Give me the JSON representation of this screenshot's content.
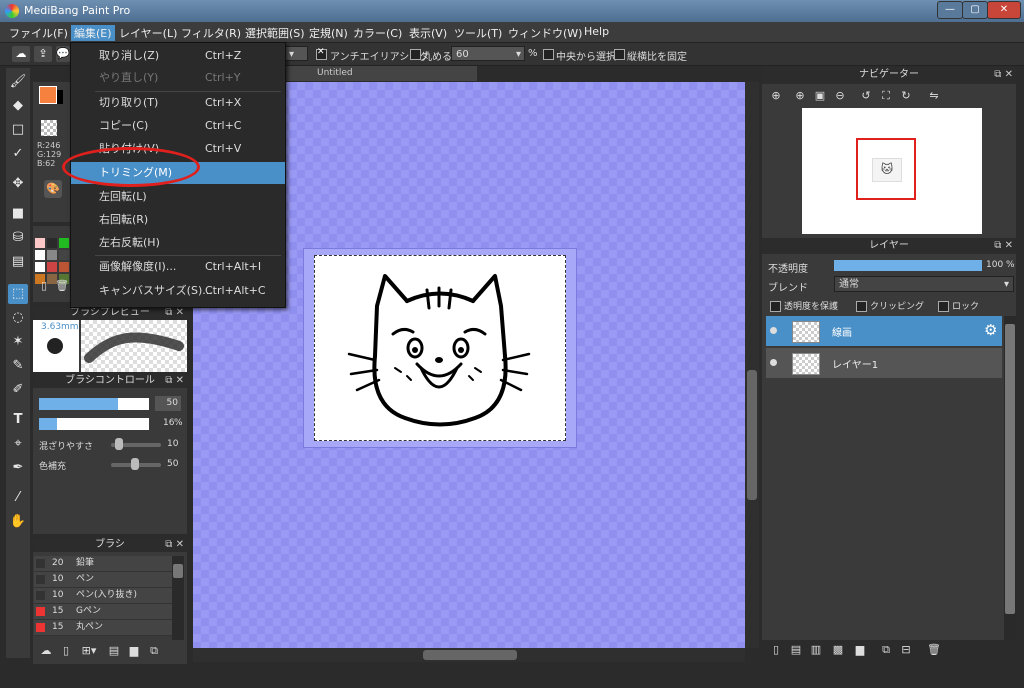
{
  "window": {
    "title": "MediBang Paint Pro",
    "min": "—",
    "max": "▢",
    "close": "✕"
  },
  "menubar": [
    "ファイル(F)",
    "編集(E)",
    "レイヤー(L)",
    "フィルタ(R)",
    "選択範囲(S)",
    "定規(N)",
    "カラー(C)",
    "表示(V)",
    "ツール(T)",
    "ウィンドウ(W)",
    "Help"
  ],
  "toolbar": {
    "antialias": "アンチエイリアシング",
    "round": "丸める",
    "round_value": "60",
    "percent": "%",
    "from_center": "中央から選択",
    "fixed_ratio": "縦横比を固定"
  },
  "edit_menu": [
    {
      "label": "取り消し(Z)",
      "shortcut": "Ctrl+Z",
      "disabled": false
    },
    {
      "label": "やり直し(Y)",
      "shortcut": "Ctrl+Y",
      "disabled": true
    },
    {
      "label": "切り取り(T)",
      "shortcut": "Ctrl+X",
      "disabled": false
    },
    {
      "label": "コピー(C)",
      "shortcut": "Ctrl+C",
      "disabled": false
    },
    {
      "label": "貼り付け(V)",
      "shortcut": "Ctrl+V",
      "disabled": false
    },
    {
      "label": "トリミング(M)",
      "shortcut": "",
      "disabled": false
    },
    {
      "label": "左回転(L)",
      "shortcut": "",
      "disabled": false
    },
    {
      "label": "右回転(R)",
      "shortcut": "",
      "disabled": false
    },
    {
      "label": "左右反転(H)",
      "shortcut": "",
      "disabled": false
    },
    {
      "label": "画像解像度(I)...",
      "shortcut": "Ctrl+Alt+I",
      "disabled": false
    },
    {
      "label": "キャンバスサイズ(S)...",
      "shortcut": "Ctrl+Alt+C",
      "disabled": false
    }
  ],
  "color": {
    "r": "R:246",
    "g": "G:129",
    "b": "B:62",
    "primary": "#f6813e"
  },
  "palette": [
    "#ffc8c8",
    "#2a2a2a",
    "#22bb22",
    "#ffffff",
    "#888888",
    "#444444",
    "#ffffff",
    "#cc4444",
    "#bb5533",
    "#cc7722",
    "#886644",
    "#557733"
  ],
  "brush_preview": {
    "title": "ブラシプレビュー",
    "size": "3.63mm"
  },
  "brush_control": {
    "title": "ブラシコントロール",
    "size_value": "50",
    "opacity_value": "16",
    "percent": "%",
    "mix_label": "混ざりやすさ",
    "mix_value": "10",
    "fill_label": "色補充",
    "fill_value": "50"
  },
  "brush_list": {
    "title": "ブラシ",
    "items": [
      {
        "color": "#333333",
        "size": "20",
        "name": "鉛筆"
      },
      {
        "color": "#333333",
        "size": "10",
        "name": "ペン"
      },
      {
        "color": "#333333",
        "size": "10",
        "name": "ペン(入り抜き)"
      },
      {
        "color": "#ee3333",
        "size": "15",
        "name": "Gペン"
      },
      {
        "color": "#ee3333",
        "size": "15",
        "name": "丸ペン"
      }
    ]
  },
  "document_tab": "Untitled",
  "navigator": {
    "title": "ナビゲーター"
  },
  "layer_panel": {
    "title": "レイヤー",
    "opacity_label": "不透明度",
    "opacity_value": "100 %",
    "opacity_fraction": 1.0,
    "blend_label": "ブレンド",
    "blend_value": "通常",
    "protect_alpha": "透明度を保護",
    "clipping": "クリッピング",
    "lock": "ロック",
    "layers": [
      {
        "name": "線画",
        "selected": true
      },
      {
        "name": "レイヤー1",
        "selected": false
      }
    ]
  },
  "colors": {
    "accent": "#4a90c8",
    "canvas_bg": "#8f8ff0",
    "highlight_ring": "#e0201c"
  }
}
